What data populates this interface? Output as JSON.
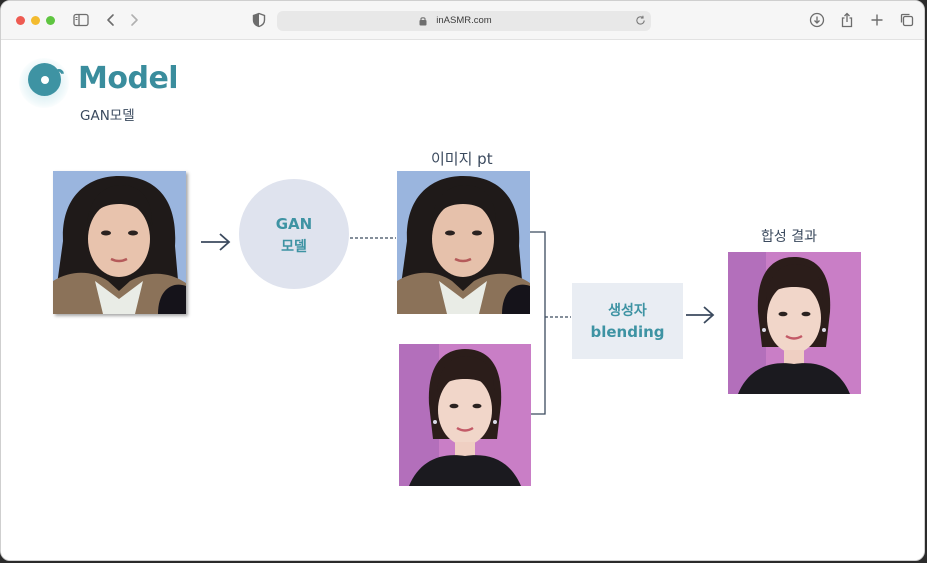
{
  "browser": {
    "url": "inASMR.com",
    "icons": [
      "sidebar-icon",
      "back-icon",
      "forward-icon",
      "shield-icon",
      "lock-icon",
      "reload-icon",
      "download-icon",
      "share-icon",
      "new-tab-icon",
      "tabs-overview-icon"
    ]
  },
  "slide": {
    "title": "Model",
    "subtitle": "GAN모델",
    "gan_box": {
      "line1": "GAN",
      "line2": "모델"
    },
    "pt_label": "이미지 pt",
    "blend_box": {
      "line1": "생성자",
      "line2": "blending"
    },
    "result_label": "합성 결과"
  },
  "colors": {
    "accent": "#3e93a3",
    "text_dark": "#3b4a5e",
    "gan_circle_bg": "#dfe3ee",
    "blend_box_bg": "#e9edf3",
    "photo_bg_blue": "#9ab5de",
    "photo_bg_pink": "#c97ec6"
  }
}
